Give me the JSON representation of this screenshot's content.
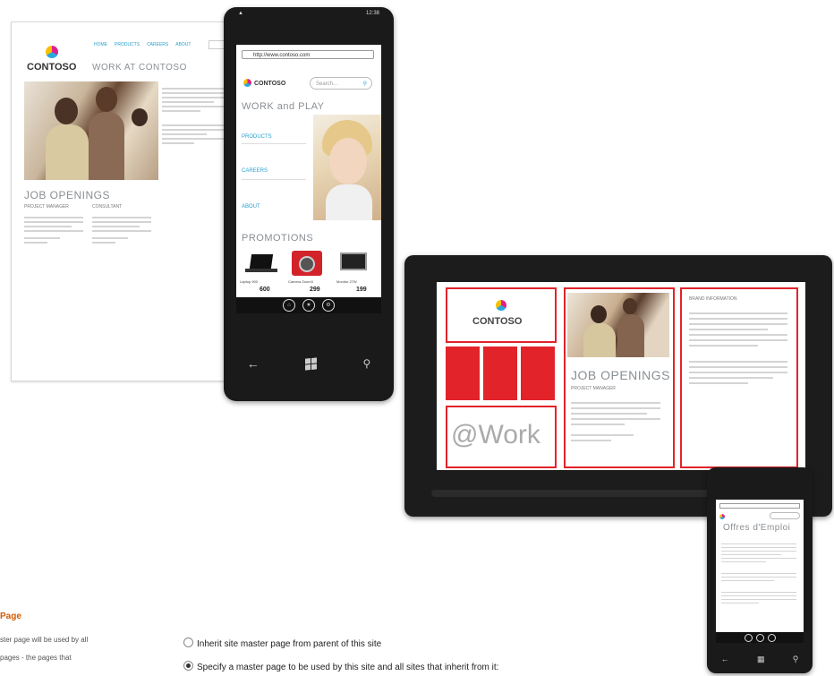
{
  "desktop": {
    "logo": "CONTOSO",
    "nav": [
      "HOME",
      "PRODUCTS",
      "CAREERS",
      "ABOUT"
    ],
    "heading": "WORK AT CONTOSO",
    "jobs_heading": "JOB OPENINGS",
    "col1": "PROJECT MANAGER",
    "col2": "CONSULTANT"
  },
  "phone": {
    "url": "http://www.contoso.com",
    "logo": "CONTOSO",
    "search_placeholder": "Search...",
    "title": "WORK and PLAY",
    "menu": [
      "PRODUCTS",
      "CAREERS",
      "ABOUT"
    ],
    "promotions": "PROMOTIONS",
    "products": [
      {
        "name": "Laptop 900",
        "price": "600"
      },
      {
        "name": "Camera Zoom3",
        "price": "299"
      },
      {
        "name": "Monitor 27W",
        "price": "199"
      }
    ],
    "time": "12:38"
  },
  "tablet": {
    "logo": "CONTOSO",
    "jobs_heading": "JOB OPENINGS",
    "role": "PROJECT MANAGER",
    "work_label": "@Work",
    "side_heading": "BRAND INFORMATION"
  },
  "small_phone": {
    "title": "Offres d'Emploi"
  },
  "settings": {
    "section_title": "Page",
    "description_line1": "ster page will be used by all",
    "description_line2": "pages - the pages that",
    "option1": "Inherit site master page from parent of this site",
    "option2": "Specify a master page to be used by this site and all sites that inherit from it:"
  },
  "colors": {
    "accent": "#e2232a",
    "section_title": "#d15a00",
    "link": "#27a0cf"
  }
}
